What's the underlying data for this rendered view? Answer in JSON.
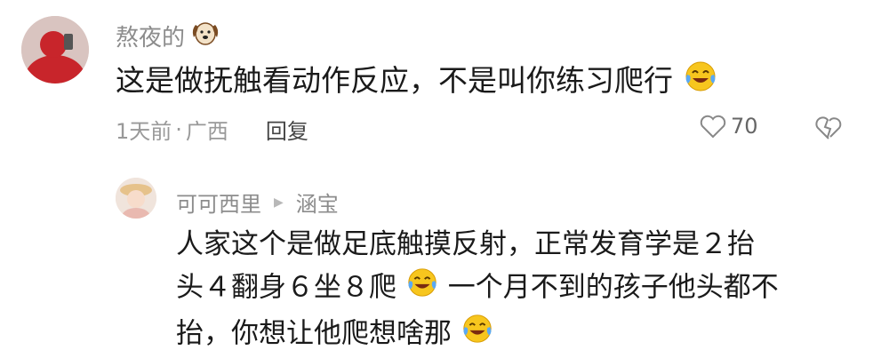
{
  "comment": {
    "author": "熬夜的",
    "author_emoji": "dog-face-icon",
    "text": "这是做抚触看动作反应，不是叫你练习爬行",
    "text_emoji": "tears-of-joy-icon",
    "time": "1天前",
    "separator": "·",
    "location": "广西",
    "reply_label": "回复",
    "likes": "70"
  },
  "reply": {
    "author": "可可西里",
    "reply_to": "涵宝",
    "line1": "人家这个是做足底触摸反射，正常发育学是２抬",
    "line2a": "头４翻身６坐８爬",
    "line2b": "一个月不到的孩子他头都不",
    "line3": "抬，你想让他爬想啥那",
    "emoji": "tears-of-joy-icon"
  },
  "colors": {
    "meta": "#999999",
    "author": "#8c8c8c",
    "text": "#1a1a1a",
    "emoji_yellow": "#f7c61e",
    "emoji_tear": "#5aa9f5"
  }
}
